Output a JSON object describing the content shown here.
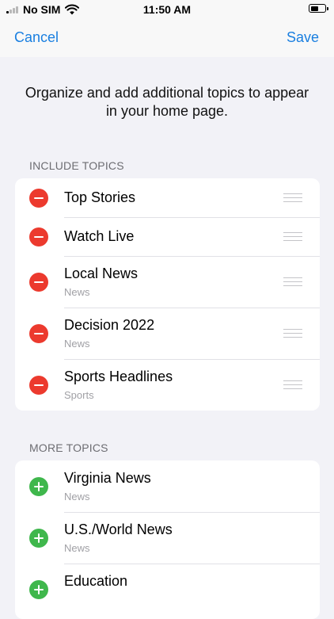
{
  "status_bar": {
    "carrier": "No SIM",
    "time": "11:50 AM",
    "battery_level": 0.45
  },
  "nav": {
    "cancel_label": "Cancel",
    "save_label": "Save"
  },
  "intro_text": "Organize and add additional topics to appear in your home page.",
  "include_section": {
    "header": "INCLUDE TOPICS",
    "items": [
      {
        "title": "Top Stories"
      },
      {
        "title": "Watch Live"
      },
      {
        "title": "Local News",
        "subtitle": "News"
      },
      {
        "title": "Decision 2022",
        "subtitle": "News"
      },
      {
        "title": "Sports Headlines",
        "subtitle": "Sports"
      }
    ]
  },
  "more_section": {
    "header": "MORE TOPICS",
    "items": [
      {
        "title": "Virginia News",
        "subtitle": "News"
      },
      {
        "title": "U.S./World News",
        "subtitle": "News"
      },
      {
        "title": "Education"
      }
    ]
  },
  "colors": {
    "accent": "#1a7fe0",
    "remove": "#ec3a2e",
    "add": "#3fb74c",
    "background": "#f2f2f7"
  }
}
